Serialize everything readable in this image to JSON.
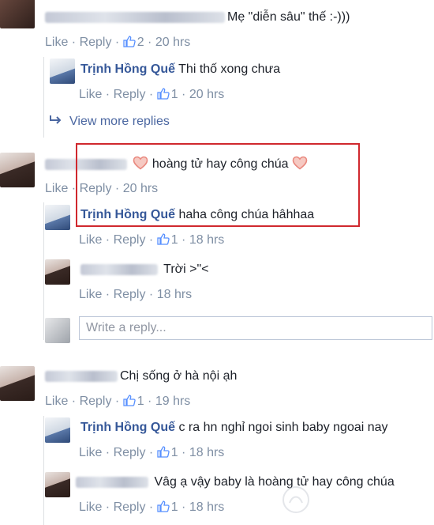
{
  "actions": {
    "like": "Like",
    "reply": "Reply",
    "sep": " · "
  },
  "comments": [
    {
      "text": "Mẹ \"diễn sâu\" thế :-)))",
      "likes": "2",
      "time": "20 hrs"
    },
    {
      "name": "Trịnh Hồng Quế",
      "text": "Thi thố xong chưa",
      "likes": "1",
      "time": "20 hrs"
    },
    {
      "view_more": "View more replies"
    },
    {
      "text": "hoàng tử hay công chúa",
      "time": "20 hrs"
    },
    {
      "name": "Trịnh Hồng Quế",
      "text": "haha công chúa hâhhaa",
      "likes": "1",
      "time": "18 hrs"
    },
    {
      "text": "Trời >\"<",
      "time": "18 hrs"
    },
    {
      "placeholder": "Write a reply..."
    },
    {
      "text": "Chị sống ở hà nội ạh",
      "likes": "1",
      "time": "19 hrs"
    },
    {
      "name": "Trịnh Hồng Quế",
      "text": "c ra hn nghỉ ngoi sinh baby ngoai nay",
      "likes": "1",
      "time": "18 hrs"
    },
    {
      "text": "Vâg ạ vậy baby là hoàng tử hay công chúa",
      "likes": "1",
      "time": "18 hrs"
    }
  ],
  "colors": {
    "name": "#365899",
    "meta": "#7f8fa4",
    "highlight": "#d0282e",
    "heart": "#e9897f"
  }
}
